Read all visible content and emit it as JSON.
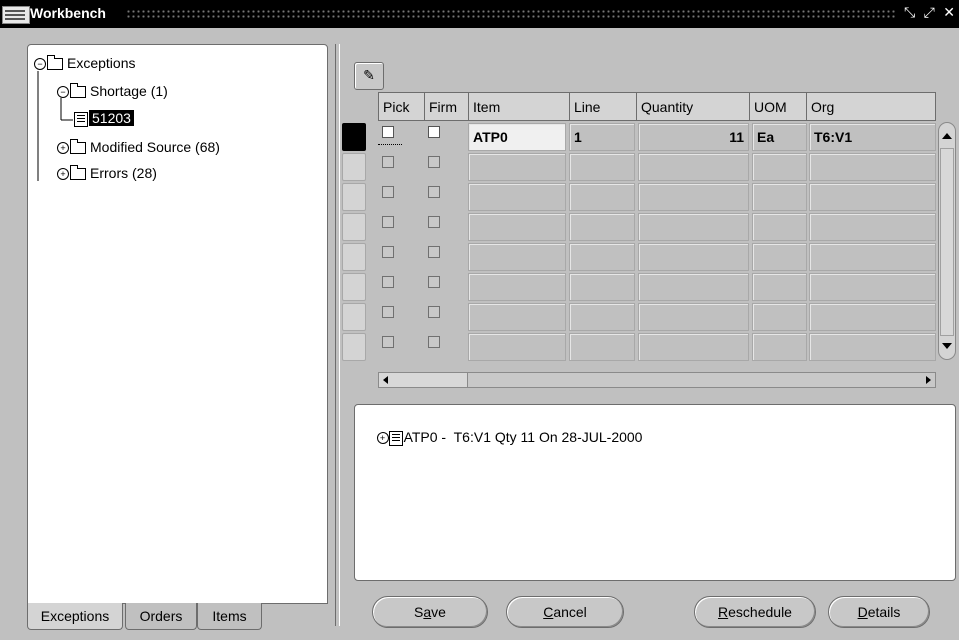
{
  "window": {
    "title": "Workbench",
    "controls": "⤡ ⤢ ✕"
  },
  "tree": {
    "root": "Exceptions",
    "shortage": "Shortage (1)",
    "shortage_child": "51203",
    "modified_source": "Modified Source (68)",
    "errors": "Errors (28)"
  },
  "tabs": {
    "exceptions": "Exceptions",
    "orders": "Orders",
    "items": "Items"
  },
  "grid": {
    "headers": {
      "pick": "Pick",
      "firm": "Firm",
      "item": "Item",
      "line": "Line",
      "quantity": "Quantity",
      "uom": "UOM",
      "org": "Org"
    },
    "rows": [
      {
        "item": "ATP0",
        "line": "1",
        "quantity": "11",
        "uom": "Ea",
        "org": "T6:V1"
      }
    ],
    "empty_rows": 7
  },
  "detail": {
    "item": "ATP0",
    "text": " -  T6:V1 Qty 11 On 28-JUL-2000"
  },
  "buttons": {
    "save": {
      "pre": "S",
      "mnemonic": "a",
      "post": "ve"
    },
    "cancel": {
      "pre": "",
      "mnemonic": "C",
      "post": "ancel"
    },
    "reschedule": {
      "pre": "",
      "mnemonic": "R",
      "post": "eschedule"
    },
    "details": {
      "pre": "",
      "mnemonic": "D",
      "post": "etails"
    }
  }
}
